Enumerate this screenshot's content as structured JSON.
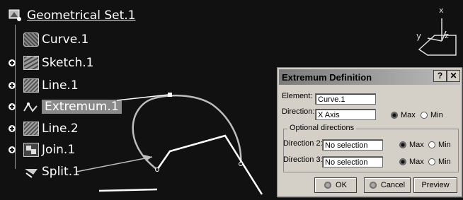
{
  "tree": {
    "root": "Geometrical Set.1",
    "items": [
      {
        "label": "Curve.1",
        "icon": "curve-icon"
      },
      {
        "label": "Sketch.1",
        "icon": "sketch-icon"
      },
      {
        "label": "Line.1",
        "icon": "line-icon"
      },
      {
        "label": "Extremum.1",
        "icon": "extremum-icon"
      },
      {
        "label": "Line.2",
        "icon": "line-icon"
      },
      {
        "label": "Join.1",
        "icon": "join-icon"
      },
      {
        "label": "Split.1",
        "icon": "split-icon"
      }
    ]
  },
  "compass": {
    "x": "x",
    "y": "y",
    "z": "z"
  },
  "dialog": {
    "title": "Extremum Definition",
    "help": "?",
    "close": "✕",
    "element_label": "Element:",
    "element_value": "Curve.1",
    "direction_label": "Direction:",
    "direction_value": "X Axis",
    "max": "Max",
    "min": "Min",
    "optional_title": "Optional directions",
    "dir2_label": "Direction 2:",
    "dir2_value": "No selection",
    "dir3_label": "Direction 3:",
    "dir3_value": "No selection",
    "ok": "OK",
    "cancel": "Cancel",
    "preview": "Preview"
  }
}
